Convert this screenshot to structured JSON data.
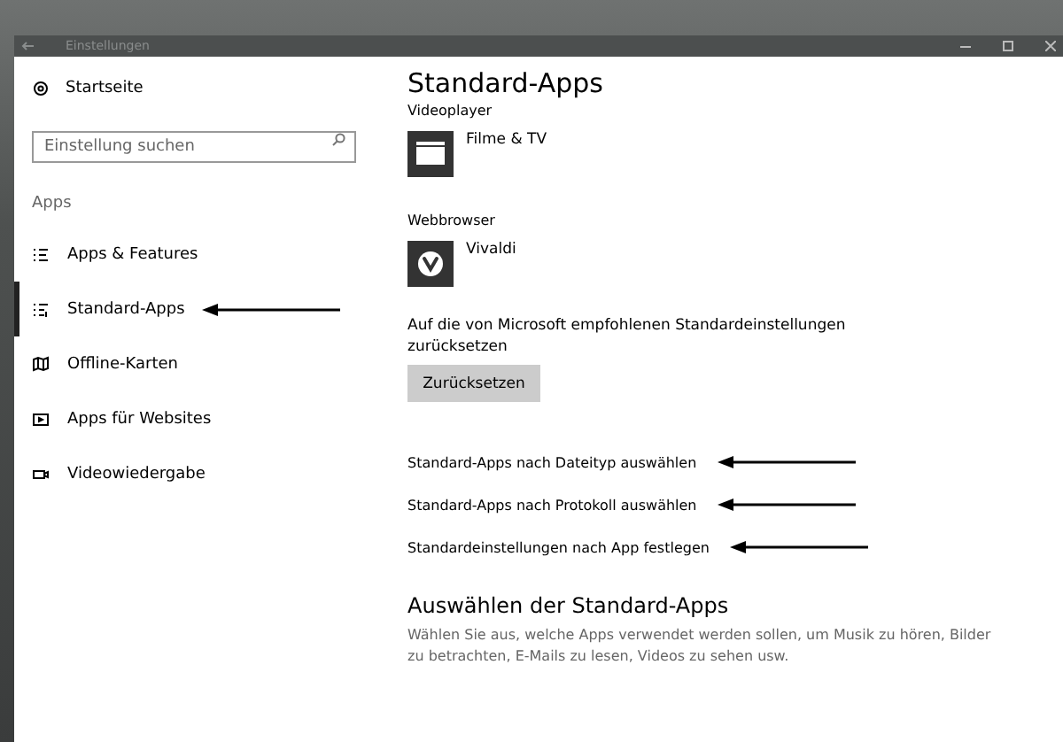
{
  "window": {
    "title": "Einstellungen"
  },
  "sidebar": {
    "home": "Startseite",
    "search": {
      "placeholder": "Einstellung suchen"
    },
    "section": "Apps",
    "items": [
      {
        "label": "Apps & Features",
        "kind": "list",
        "selected": false,
        "arrow": false
      },
      {
        "label": "Standard-Apps",
        "kind": "defaults",
        "selected": true,
        "arrow": true
      },
      {
        "label": "Offline-Karten",
        "kind": "map",
        "selected": false,
        "arrow": false
      },
      {
        "label": "Apps für Websites",
        "kind": "web",
        "selected": false,
        "arrow": false
      },
      {
        "label": "Videowiedergabe",
        "kind": "video",
        "selected": false,
        "arrow": false
      }
    ]
  },
  "main": {
    "title": "Standard-Apps",
    "groups": [
      {
        "heading": "Videoplayer",
        "app": "Filme & TV",
        "kind": "film"
      },
      {
        "heading": "Webbrowser",
        "app": "Vivaldi",
        "kind": "vivaldi"
      }
    ],
    "reset": {
      "text": "Auf die von Microsoft empfohlenen Standardeinstellungen zurücksetzen",
      "button": "Zurücksetzen"
    },
    "links": [
      {
        "label": "Standard-Apps nach Dateityp auswählen",
        "arrow": true
      },
      {
        "label": "Standard-Apps nach Protokoll auswählen",
        "arrow": true
      },
      {
        "label": "Standardeinstellungen nach App festlegen",
        "arrow": true
      }
    ],
    "section": {
      "title": "Auswählen der Standard-Apps",
      "text": "Wählen Sie aus, welche Apps verwendet werden sollen, um Musik zu hören, Bilder zu betrachten, E-Mails zu lesen, Videos zu sehen usw."
    }
  }
}
